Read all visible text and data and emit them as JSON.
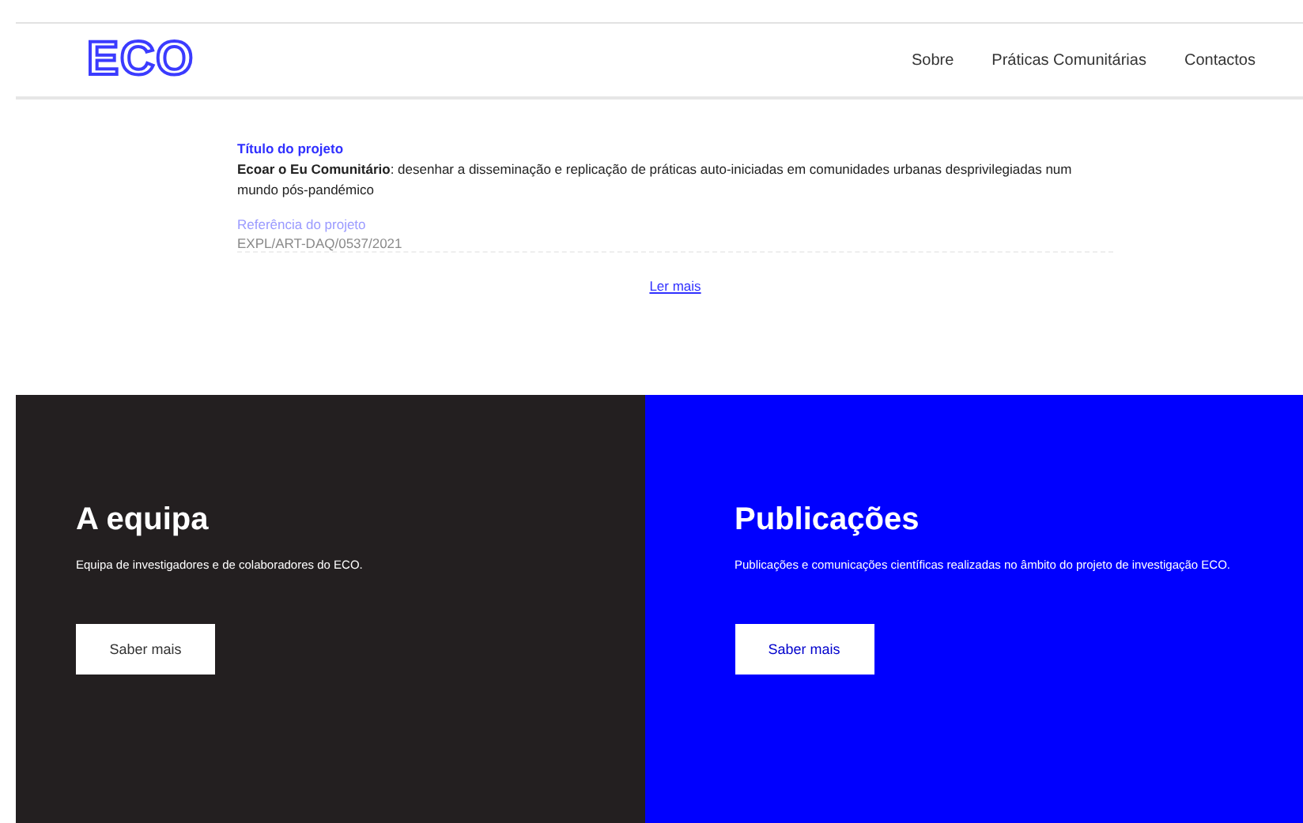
{
  "header": {
    "logo": "ECO",
    "nav": [
      {
        "label": "Sobre"
      },
      {
        "label": "Práticas Comunitárias"
      },
      {
        "label": "Contactos"
      }
    ]
  },
  "project": {
    "title_label": "Título do projeto",
    "title": "**Ecoar o Eu Comunitário**: desenhar a disseminação e replicação de práticas auto-iniciadas em comunidades urbanas desprivilegiadas num mundo pós-pandémico",
    "reference_label": "Referência do projeto",
    "reference": "EXPL/ART-DAQ/0537/2021",
    "more_link": "Ler mais"
  },
  "panels": [
    {
      "kind": "dark",
      "title": "A equipa",
      "text": "Equipa de investigadores e de colaboradores do ECO.",
      "button": "Saber mais"
    },
    {
      "kind": "blue",
      "title": "Publicações",
      "text": "Publicações e comunicações científicas realizadas no âmbito do projeto de investigação ECO.",
      "button": "Saber mais"
    }
  ]
}
